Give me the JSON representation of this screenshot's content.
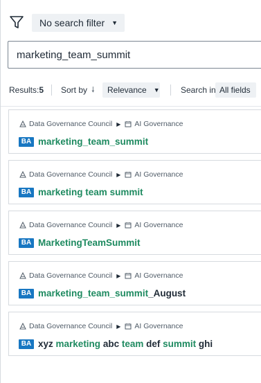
{
  "filter": {
    "label": "No search filter"
  },
  "search": {
    "value": "marketing_team_summit"
  },
  "controls": {
    "results_label": "Results:",
    "results_count": "5",
    "sort_by_label": "Sort by",
    "sort_value": "Relevance",
    "search_in_label": "Search in",
    "search_in_value": "All fields"
  },
  "results": [
    {
      "crumb1": "Data Governance Council",
      "crumb2": "AI Governance",
      "badge": "BA",
      "title_parts": [
        {
          "t": "marketing_team_summit",
          "hl": true
        }
      ]
    },
    {
      "crumb1": "Data Governance Council",
      "crumb2": "AI Governance",
      "badge": "BA",
      "title_parts": [
        {
          "t": "marketing",
          "hl": true
        },
        {
          "t": " ",
          "hl": false
        },
        {
          "t": "team",
          "hl": true
        },
        {
          "t": " ",
          "hl": false
        },
        {
          "t": "summit",
          "hl": true
        }
      ]
    },
    {
      "crumb1": "Data Governance Council",
      "crumb2": "AI Governance",
      "badge": "BA",
      "title_parts": [
        {
          "t": "MarketingTeamSummit",
          "hl": true
        }
      ]
    },
    {
      "crumb1": "Data Governance Council",
      "crumb2": "AI Governance",
      "badge": "BA",
      "title_parts": [
        {
          "t": "marketing_team_summit",
          "hl": true
        },
        {
          "t": "_August",
          "hl": false
        }
      ]
    },
    {
      "crumb1": "Data Governance Council",
      "crumb2": "AI Governance",
      "badge": "BA",
      "title_parts": [
        {
          "t": "xyz ",
          "hl": false
        },
        {
          "t": "marketing",
          "hl": true
        },
        {
          "t": " abc ",
          "hl": false
        },
        {
          "t": "team",
          "hl": true
        },
        {
          "t": " def ",
          "hl": false
        },
        {
          "t": "summit",
          "hl": true
        },
        {
          "t": " ghi",
          "hl": false
        }
      ]
    }
  ]
}
